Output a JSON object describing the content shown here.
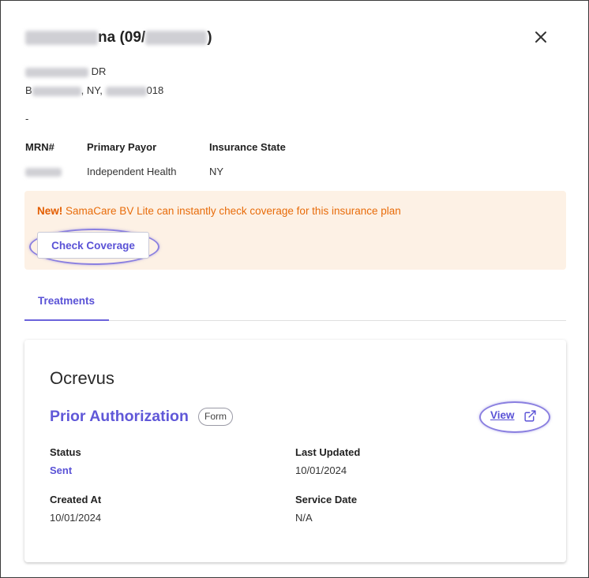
{
  "header": {
    "name_suffix": "na (09/",
    "name_close": ")"
  },
  "address": {
    "line1_suffix": "DR",
    "line2_prefix": "B",
    "line2_mid": ", NY,",
    "line2_suffix": "018"
  },
  "contact_placeholder": "-",
  "info": {
    "mrn_label": "MRN#",
    "payor_label": "Primary Payor",
    "payor_value": "Independent Health",
    "state_label": "Insurance State",
    "state_value": "NY"
  },
  "banner": {
    "new_label": "New!",
    "message": "SamaCare BV Lite can instantly check coverage for this insurance plan",
    "button_label": "Check Coverage"
  },
  "tabs": [
    {
      "label": "Treatments",
      "active": true
    }
  ],
  "treatment": {
    "drug": "Ocrevus",
    "request_type": "Prior Authorization",
    "badge": "Form",
    "view_label": "View",
    "status_label": "Status",
    "status_value": "Sent",
    "last_updated_label": "Last Updated",
    "last_updated_value": "10/01/2024",
    "created_label": "Created At",
    "created_value": "10/01/2024",
    "service_label": "Service Date",
    "service_value": "N/A"
  },
  "colors": {
    "accent": "#5a52d6",
    "banner_bg": "#fdf1e5",
    "banner_text": "#e86c0a"
  },
  "icons": {
    "close": "close-icon",
    "external": "external-link-icon"
  }
}
